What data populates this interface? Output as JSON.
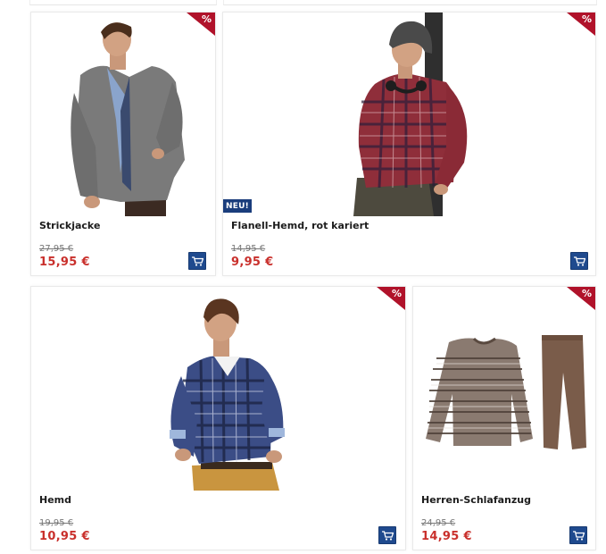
{
  "products": [
    {
      "name": "Strickjacke",
      "old_price": "27,95 €",
      "new_price": "15,95 €",
      "sale_badge": "%",
      "image_alt": "cardigan-photo"
    },
    {
      "name": "Flanell-Hemd, rot kariert",
      "old_price": "14,95 €",
      "new_price": "9,95 €",
      "sale_badge": "%",
      "new_badge": "NEU!",
      "image_alt": "flannel-shirt-photo"
    },
    {
      "name": "Hemd",
      "old_price": "19,95 €",
      "new_price": "10,95 €",
      "sale_badge": "%",
      "image_alt": "shirt-photo"
    },
    {
      "name": "Herren-Schlafanzug",
      "old_price": "24,95 €",
      "new_price": "14,95 €",
      "sale_badge": "%",
      "image_alt": "pajama-photo"
    }
  ],
  "colors": {
    "price_red": "#c9302c",
    "cart_blue": "#1f4a8e",
    "sale_red": "#b0122a",
    "neu_blue": "#1a3d7c"
  },
  "icons": {
    "cart": "shopping-cart-icon",
    "sale": "percent-icon"
  }
}
